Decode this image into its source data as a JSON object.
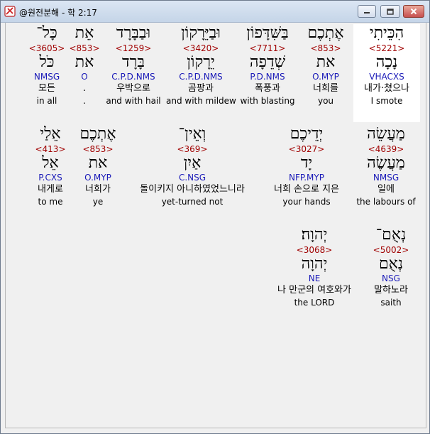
{
  "window": {
    "title": "@원전분해 - 학 2:17"
  },
  "rows": [
    [
      {
        "heb": "הִכֵּיתִי",
        "num": "<5221>",
        "lemma": "נָכָה",
        "parse": "VHACXS",
        "kor": "내가·쳤으나",
        "eng": "I smote",
        "highlight": true
      },
      {
        "heb": "אֶתְכֶם",
        "num": "<853>",
        "lemma": "את",
        "parse": "O.MYP",
        "kor": "너희를",
        "eng": "you"
      },
      {
        "heb": "בַּשִּׁדָּפוֹן",
        "num": "<7711>",
        "lemma": "שְׁדֵפָה",
        "parse": "P.D.NMS",
        "kor": "폭풍과",
        "eng": "with blasting"
      },
      {
        "heb": "וּבַיֵּרָקוֹן",
        "num": "<3420>",
        "lemma": "יֵרָקוֹן",
        "parse": "C.P.D.NMS",
        "kor": "곰팡과",
        "eng": "and with mildew"
      },
      {
        "heb": "וּבַבָּרָד",
        "num": "<1259>",
        "lemma": "בָּרָד",
        "parse": "C.P.D.NMS",
        "kor": "우박으로",
        "eng": "and with hail"
      },
      {
        "heb": "אֵת",
        "num": "<853>",
        "lemma": "את",
        "parse": "O",
        "kor": ".",
        "eng": "."
      },
      {
        "heb": "כָּל־",
        "num": "<3605>",
        "lemma": "כֹּל",
        "parse": "NMSG",
        "kor": "모든",
        "eng": "in all"
      }
    ],
    [
      {
        "heb": "מַעֲשֵׂה",
        "num": "<4639>",
        "lemma": "מַעֲשֶׂה",
        "parse": "NMSG",
        "kor": "일에",
        "eng": "the labours of"
      },
      {
        "heb": "יְדֵיכֶם",
        "num": "<3027>",
        "lemma": "יָד",
        "parse": "NFP.MYP",
        "kor": "너희 손으로 지은",
        "eng": "your hands"
      },
      {
        "heb": "וְאֵין־",
        "num": "<369>",
        "lemma": "אַיִן",
        "parse": "C.NSG",
        "kor": "돌이키지 아니하였었느니라",
        "eng": "yet-turned not"
      },
      {
        "heb": "אֶתְכֶם",
        "num": "<853>",
        "lemma": "את",
        "parse": "O.MYP",
        "kor": "너희가",
        "eng": "ye"
      },
      {
        "heb": "אֵלַי",
        "num": "<413>",
        "lemma": "אֵל",
        "parse": "P.CXS",
        "kor": "내게로",
        "eng": "to me"
      }
    ],
    [
      {
        "heb": "נְאֻם־",
        "num": "<5002>",
        "lemma": "נְאֻם",
        "parse": "NSG",
        "kor": "말하노라",
        "eng": "saith"
      },
      {
        "heb": "יְהוָה׃",
        "num": "<3068>",
        "lemma": "יְהוָה",
        "parse": "NE",
        "kor": "나 만군의 여호와가",
        "eng": "the LORD"
      }
    ]
  ]
}
